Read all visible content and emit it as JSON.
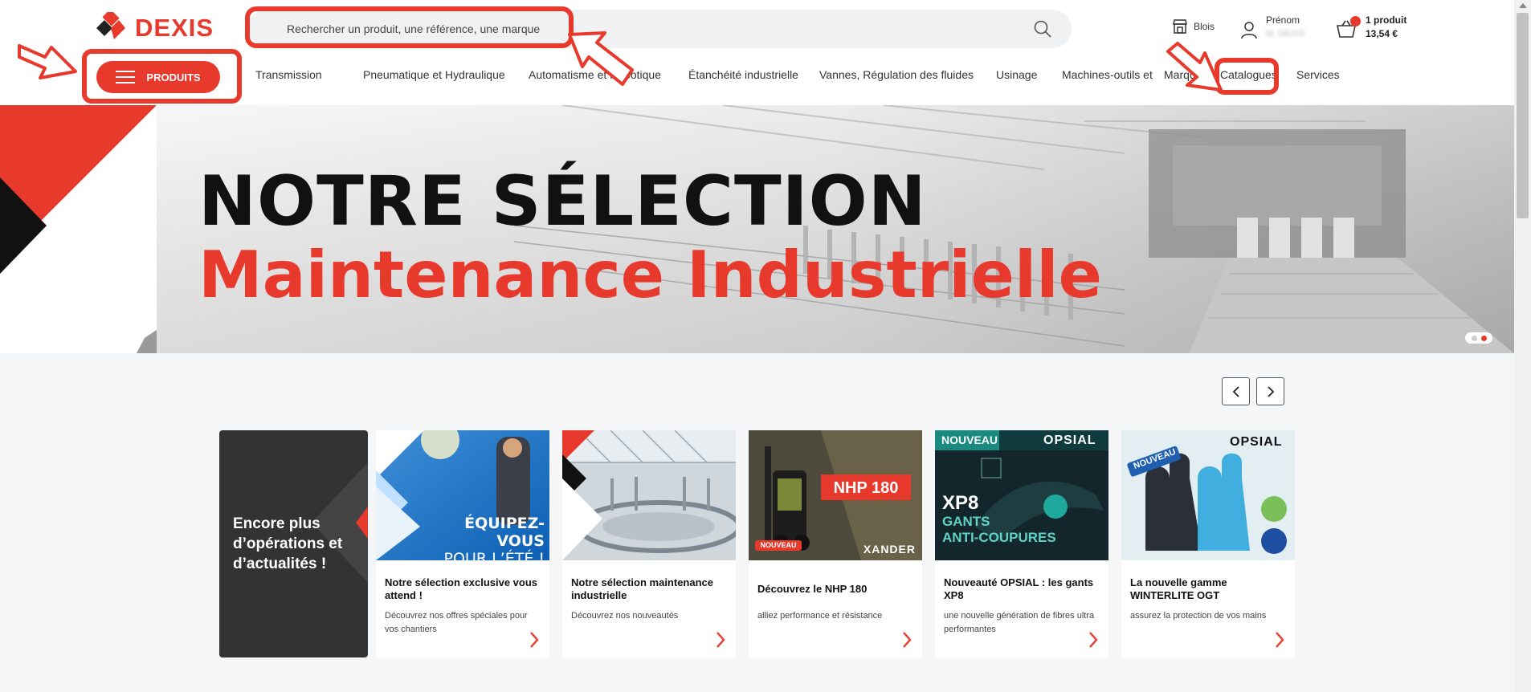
{
  "brand": {
    "name": "DEXIS",
    "accent": "#e8392d",
    "dark": "#333333"
  },
  "search": {
    "placeholder": "Rechercher un produit, une référence, une marque",
    "icon": "search-icon"
  },
  "header": {
    "store_label": "Blois",
    "account_label": "Prénom",
    "account_sub": "M. DEXIS",
    "cart_count": "1 produit",
    "cart_total": "13,54 €"
  },
  "products_button": "PRODUITS",
  "nav": {
    "items": [
      "Transmission",
      "Pneumatique et Hydraulique",
      "Automatisme et Robotique",
      "Étanchéité industrielle",
      "Vannes, Régulation des fluides",
      "Usinage",
      "Machines-outils et",
      "Marques",
      "Catalogues",
      "Services"
    ]
  },
  "hero": {
    "title": "NOTRE SÉLECTION",
    "subtitle": "Maintenance Industrielle",
    "slides": 2,
    "active_slide": 2
  },
  "promo": {
    "text": "Encore plus d’opérations et d’actualités !"
  },
  "cards": [
    {
      "title": "Notre sélection exclusive vous attend !",
      "desc": "Découvrez nos offres spéciales pour vos chantiers",
      "image_text_1": "ÉQUIPEZ-VOUS",
      "image_text_2": "POUR L’ÉTÉ !"
    },
    {
      "title": "Notre sélection maintenance industrielle",
      "desc": "Découvrez nos nouveautés"
    },
    {
      "title": "Découvrez le NHP 180",
      "desc": "alliez performance et résistance",
      "image_badge": "NHP 180",
      "image_tag": "NOUVEAU",
      "image_brand": "XANDER"
    },
    {
      "title": "Nouveauté OPSIAL : les gants XP8",
      "desc": "une nouvelle génération de fibres ultra performantes",
      "image_tag": "NOUVEAU",
      "image_brand": "OPSIAL",
      "image_text_1": "XP8",
      "image_text_2": "GANTS",
      "image_text_3": "ANTI-COUPURES"
    },
    {
      "title": "La nouvelle gamme WINTERLITE OGT",
      "desc": "assurez la protection de vos mains",
      "image_tag": "NOUVEAU",
      "image_brand": "OPSIAL"
    }
  ]
}
